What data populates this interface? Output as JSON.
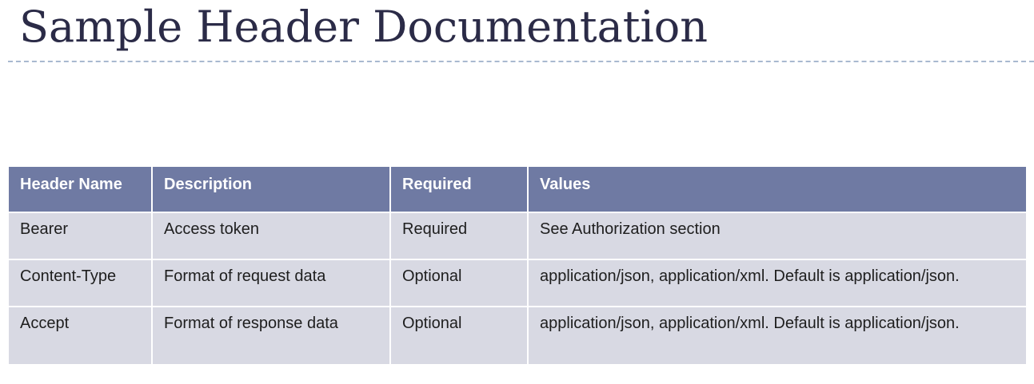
{
  "title": "Sample Header Documentation",
  "table": {
    "headers": [
      "Header Name",
      "Description",
      "Required",
      "Values"
    ],
    "rows": [
      [
        "Bearer",
        "Access token",
        "Required",
        "See Authorization section"
      ],
      [
        "Content-Type",
        "Format of request data",
        "Optional",
        "application/json, application/xml. Default is application/json."
      ],
      [
        "Accept",
        "Format of response data",
        "Optional",
        "application/json, application/xml. Default is application/json."
      ]
    ]
  },
  "colors": {
    "title": "#2b2b47",
    "divider": "#a9b9d0",
    "header_bg": "#6f7aa3",
    "header_text": "#ffffff",
    "cell_bg": "#d8d9e3",
    "cell_text": "#1e1e1e"
  }
}
